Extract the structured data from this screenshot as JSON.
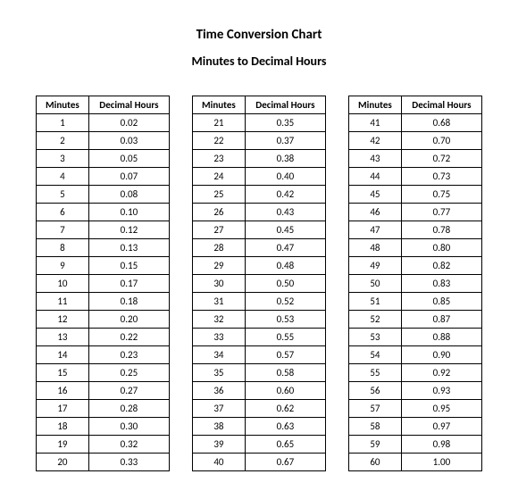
{
  "title": "Time Conversion Chart",
  "subtitle": "Minutes to Decimal Hours",
  "headers": {
    "minutes": "Minutes",
    "decimal": "Decimal Hours"
  },
  "columns": [
    [
      {
        "m": "1",
        "d": "0.02"
      },
      {
        "m": "2",
        "d": "0.03"
      },
      {
        "m": "3",
        "d": "0.05"
      },
      {
        "m": "4",
        "d": "0.07"
      },
      {
        "m": "5",
        "d": "0.08"
      },
      {
        "m": "6",
        "d": "0.10"
      },
      {
        "m": "7",
        "d": "0.12"
      },
      {
        "m": "8",
        "d": "0.13"
      },
      {
        "m": "9",
        "d": "0.15"
      },
      {
        "m": "10",
        "d": "0.17"
      },
      {
        "m": "11",
        "d": "0.18"
      },
      {
        "m": "12",
        "d": "0.20"
      },
      {
        "m": "13",
        "d": "0.22"
      },
      {
        "m": "14",
        "d": "0.23"
      },
      {
        "m": "15",
        "d": "0.25"
      },
      {
        "m": "16",
        "d": "0.27"
      },
      {
        "m": "17",
        "d": "0.28"
      },
      {
        "m": "18",
        "d": "0.30"
      },
      {
        "m": "19",
        "d": "0.32"
      },
      {
        "m": "20",
        "d": "0.33"
      }
    ],
    [
      {
        "m": "21",
        "d": "0.35"
      },
      {
        "m": "22",
        "d": "0.37"
      },
      {
        "m": "23",
        "d": "0.38"
      },
      {
        "m": "24",
        "d": "0.40"
      },
      {
        "m": "25",
        "d": "0.42"
      },
      {
        "m": "26",
        "d": "0.43"
      },
      {
        "m": "27",
        "d": "0.45"
      },
      {
        "m": "28",
        "d": "0.47"
      },
      {
        "m": "29",
        "d": "0.48"
      },
      {
        "m": "30",
        "d": "0.50"
      },
      {
        "m": "31",
        "d": "0.52"
      },
      {
        "m": "32",
        "d": "0.53"
      },
      {
        "m": "33",
        "d": "0.55"
      },
      {
        "m": "34",
        "d": "0.57"
      },
      {
        "m": "35",
        "d": "0.58"
      },
      {
        "m": "36",
        "d": "0.60"
      },
      {
        "m": "37",
        "d": "0.62"
      },
      {
        "m": "38",
        "d": "0.63"
      },
      {
        "m": "39",
        "d": "0.65"
      },
      {
        "m": "40",
        "d": "0.67"
      }
    ],
    [
      {
        "m": "41",
        "d": "0.68"
      },
      {
        "m": "42",
        "d": "0.70"
      },
      {
        "m": "43",
        "d": "0.72"
      },
      {
        "m": "44",
        "d": "0.73"
      },
      {
        "m": "45",
        "d": "0.75"
      },
      {
        "m": "46",
        "d": "0.77"
      },
      {
        "m": "47",
        "d": "0.78"
      },
      {
        "m": "48",
        "d": "0.80"
      },
      {
        "m": "49",
        "d": "0.82"
      },
      {
        "m": "50",
        "d": "0.83"
      },
      {
        "m": "51",
        "d": "0.85"
      },
      {
        "m": "52",
        "d": "0.87"
      },
      {
        "m": "53",
        "d": "0.88"
      },
      {
        "m": "54",
        "d": "0.90"
      },
      {
        "m": "55",
        "d": "0.92"
      },
      {
        "m": "56",
        "d": "0.93"
      },
      {
        "m": "57",
        "d": "0.95"
      },
      {
        "m": "58",
        "d": "0.97"
      },
      {
        "m": "59",
        "d": "0.98"
      },
      {
        "m": "60",
        "d": "1.00"
      }
    ]
  ]
}
